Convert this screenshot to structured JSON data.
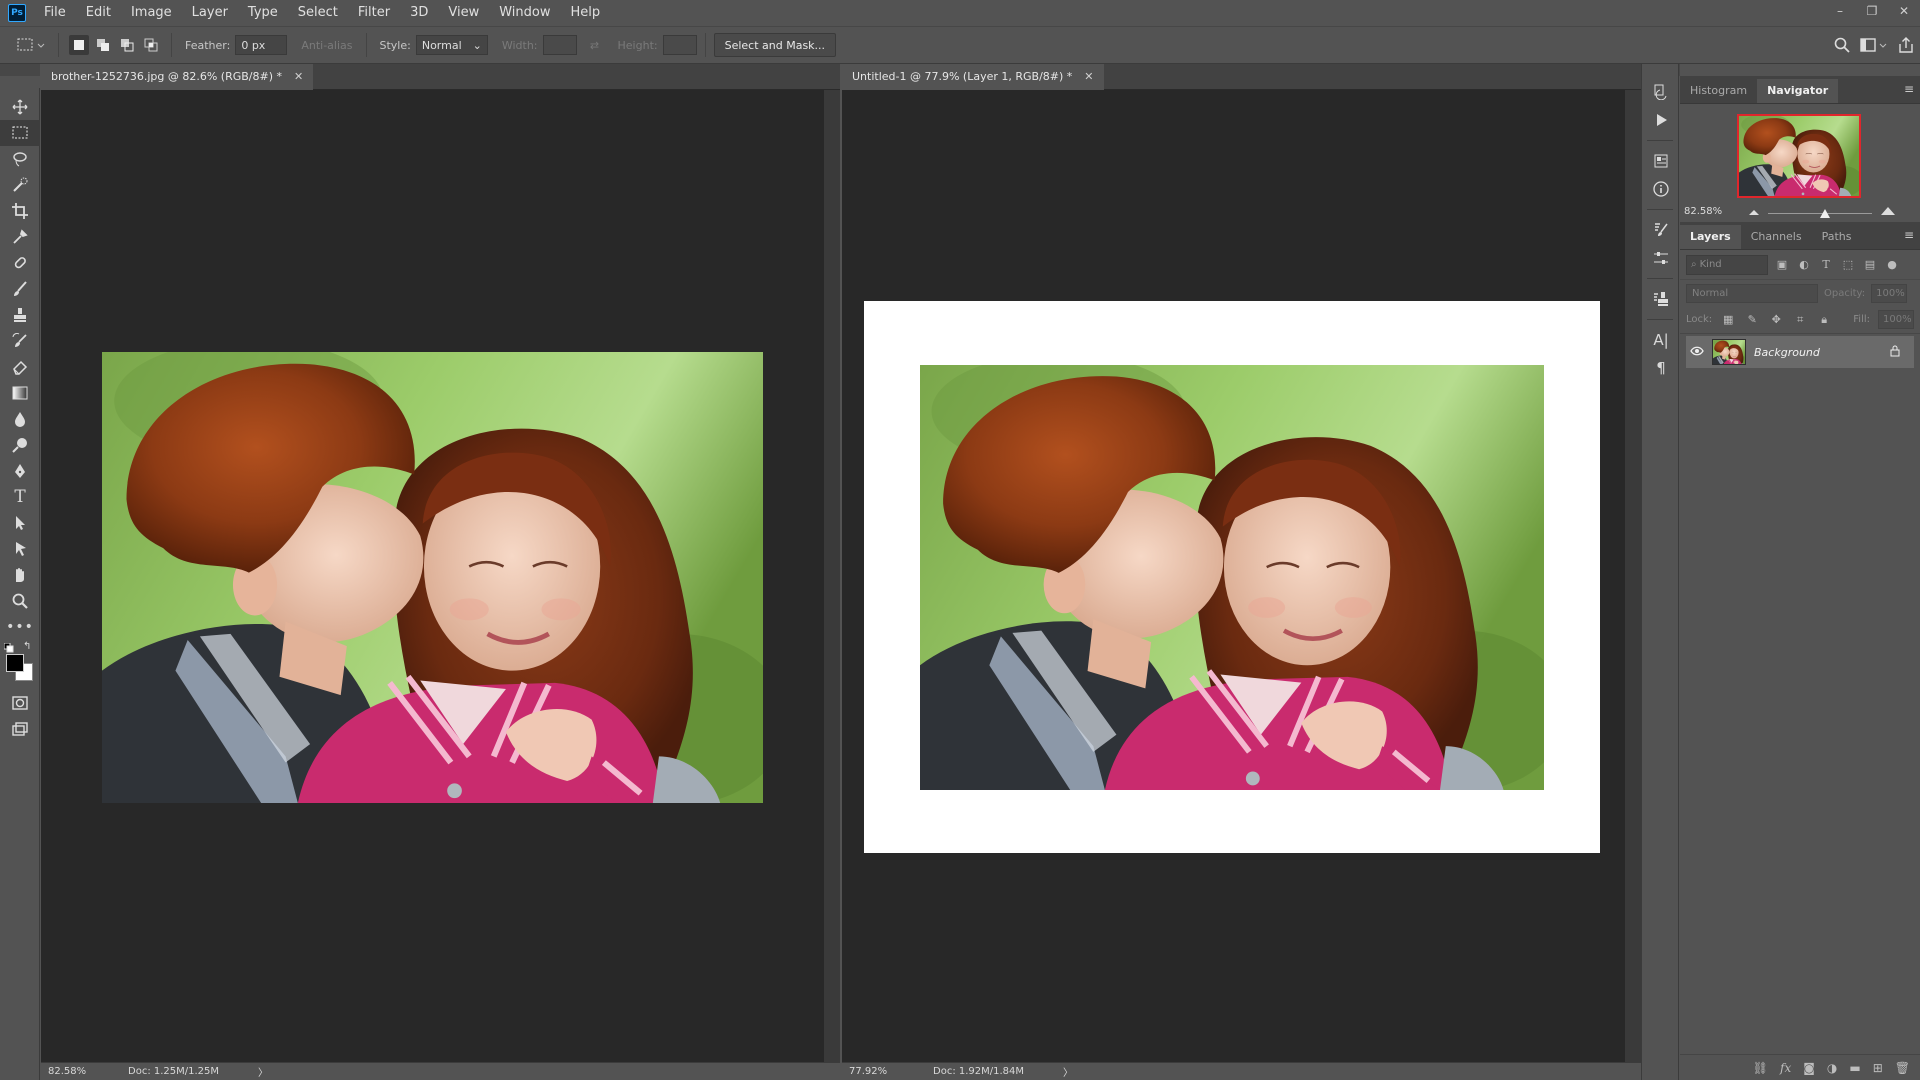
{
  "app": {
    "logo": "Ps"
  },
  "menu": [
    "File",
    "Edit",
    "Image",
    "Layer",
    "Type",
    "Select",
    "Filter",
    "3D",
    "View",
    "Window",
    "Help"
  ],
  "window_controls": [
    "–",
    "❐",
    "✕"
  ],
  "options": {
    "feather_label": "Feather:",
    "feather_value": "0 px",
    "antialias_label": "Anti-alias",
    "style_label": "Style:",
    "style_value": "Normal",
    "width_label": "Width:",
    "height_label": "Height:",
    "select_mask_label": "Select and Mask..."
  },
  "documents": [
    {
      "tab_title": "brother-1252736.jpg @ 82.6% (RGB/8#) *",
      "zoom": "82.58%",
      "doc_size": "Doc: 1.25M/1.25M"
    },
    {
      "tab_title": "Untitled-1 @ 77.9% (Layer 1, RGB/8#) *",
      "zoom": "77.92%",
      "doc_size": "Doc: 1.92M/1.84M"
    }
  ],
  "navigator": {
    "tabs": [
      "Histogram",
      "Navigator"
    ],
    "active_tab": "Navigator",
    "zoom": "82.58%",
    "slider_position": 0.55
  },
  "layers_panel": {
    "tabs": [
      "Layers",
      "Channels",
      "Paths"
    ],
    "active_tab": "Layers",
    "kind_placeholder": "Kind",
    "blend_mode": "Normal",
    "opacity_label": "Opacity:",
    "opacity_value": "100%",
    "lock_label": "Lock:",
    "fill_label": "Fill:",
    "fill_value": "100%",
    "layers": [
      {
        "name": "Background",
        "visible": true,
        "locked": true
      }
    ]
  },
  "colors": {
    "ui_bg": "#535353",
    "canvas_bg": "#282828",
    "nav_frame": "#e0262c",
    "selected_layer": "#6a6a6a"
  }
}
